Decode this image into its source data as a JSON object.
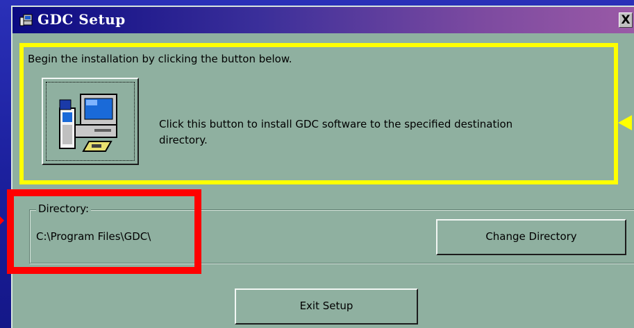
{
  "window": {
    "title": "GDC Setup",
    "close_label": "X"
  },
  "install": {
    "intro": "Begin the installation by clicking the button below.",
    "description": "Click this button to install GDC software to the specified destination directory."
  },
  "directory": {
    "label": "Directory:",
    "path": "C:\\Program Files\\GDC\\",
    "change_button": "Change Directory"
  },
  "footer": {
    "exit_button": "Exit Setup"
  },
  "colors": {
    "dialog_bg": "#8fb0a0",
    "highlight_yellow": "#ffff00",
    "highlight_red": "#ff0000",
    "slide_bg": "#1a1e9a"
  },
  "icons": {
    "title": "setup-computer-icon",
    "install": "computer-install-icon"
  }
}
